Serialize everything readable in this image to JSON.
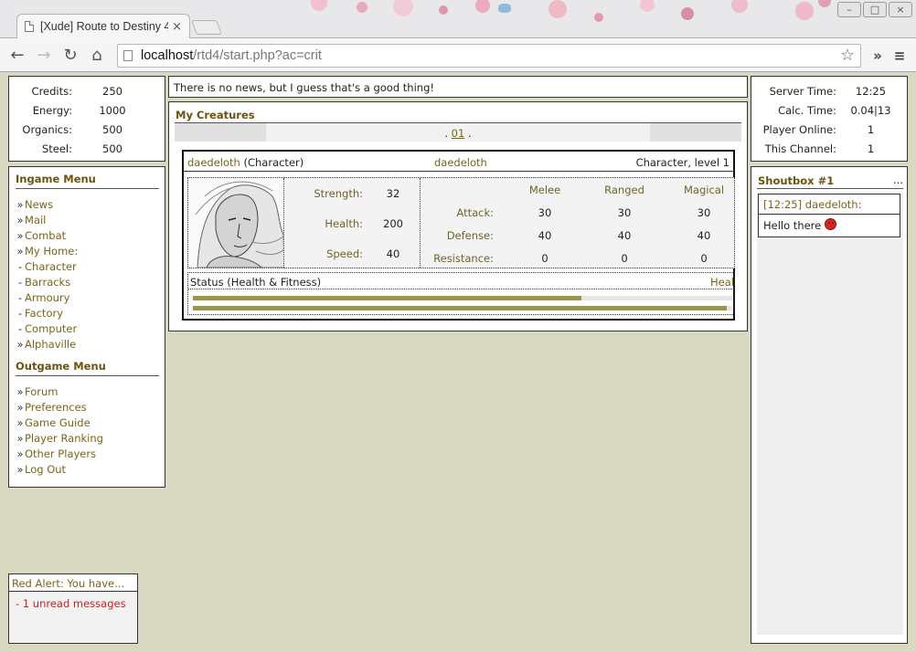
{
  "browser": {
    "tab_title": "[Xude] Route to Destiny 4",
    "tab_close": "×",
    "url_host": "localhost",
    "url_path": "/rtd4/start.php?ac=crit",
    "nav_back": "←",
    "nav_forward": "→",
    "nav_reload": "↻",
    "nav_home": "⌂",
    "star": "☆",
    "overflow": "»",
    "menu": "≡",
    "win_min": "–",
    "win_max": "□",
    "win_close": "×"
  },
  "resources": [
    {
      "label": "Credits:",
      "value": "250"
    },
    {
      "label": "Energy:",
      "value": "1000"
    },
    {
      "label": "Organics:",
      "value": "500"
    },
    {
      "label": "Steel:",
      "value": "500"
    }
  ],
  "ingame_menu": {
    "title": "Ingame Menu",
    "items": [
      {
        "bullet": "»",
        "label": "News"
      },
      {
        "bullet": "»",
        "label": "Mail"
      },
      {
        "bullet": "»",
        "label": "Combat"
      },
      {
        "bullet": "»",
        "label": "My Home:"
      },
      {
        "bullet": "-",
        "label": "Character"
      },
      {
        "bullet": "-",
        "label": "Barracks"
      },
      {
        "bullet": "-",
        "label": "Armoury"
      },
      {
        "bullet": "-",
        "label": "Factory"
      },
      {
        "bullet": "-",
        "label": "Computer"
      },
      {
        "bullet": "»",
        "label": "Alphaville"
      }
    ]
  },
  "outgame_menu": {
    "title": "Outgame Menu",
    "items": [
      {
        "bullet": "»",
        "label": "Forum"
      },
      {
        "bullet": "»",
        "label": "Preferences"
      },
      {
        "bullet": "»",
        "label": "Game Guide"
      },
      {
        "bullet": "»",
        "label": "Player Ranking"
      },
      {
        "bullet": "»",
        "label": "Other Players"
      },
      {
        "bullet": "»",
        "label": "Log Out"
      }
    ]
  },
  "red_alert": {
    "title": "Red Alert: You have...",
    "message": "- 1 unread messages"
  },
  "news": {
    "text": "There is no news, but I guess that's a good thing!"
  },
  "creatures": {
    "title": "My Creatures",
    "pager_prefix": ".",
    "pager_page": "01",
    "pager_suffix": ".",
    "card": {
      "name": "daedeloth",
      "type": "(Character)",
      "owner": "daedeloth",
      "level_text": "Character, level 1",
      "base_stats": [
        {
          "label": "Strength:",
          "value": "32"
        },
        {
          "label": "Health:",
          "value": "200"
        },
        {
          "label": "Speed:",
          "value": "40"
        }
      ],
      "combat_columns": [
        "Melee",
        "Ranged",
        "Magical"
      ],
      "combat_rows": [
        {
          "label": "Attack:",
          "values": [
            "30",
            "30",
            "30"
          ]
        },
        {
          "label": "Defense:",
          "values": [
            "40",
            "40",
            "40"
          ]
        },
        {
          "label": "Resistance:",
          "values": [
            "0",
            "0",
            "0"
          ]
        }
      ],
      "status_label": "Status (Health & Fitness)",
      "heal_label": "Heal",
      "health_fraction": 0.72,
      "fitness_fraction": 0.99
    }
  },
  "server": [
    {
      "label": "Server Time:",
      "value": "12:25"
    },
    {
      "label": "Calc. Time:",
      "value": "0.04|13"
    },
    {
      "label": "Player Online:",
      "value": "1"
    },
    {
      "label": "This Channel:",
      "value": "1"
    }
  ],
  "shoutbox": {
    "title": "Shoutbox #1",
    "more": "...",
    "message_header": "[12:25] daedeloth:",
    "message_body": "Hello there"
  },
  "colors": {
    "page_bg": "#d9d8c0",
    "accent_gold": "#7a6418",
    "bar_olive": "#9b9546",
    "alert_red": "#cc2222"
  }
}
